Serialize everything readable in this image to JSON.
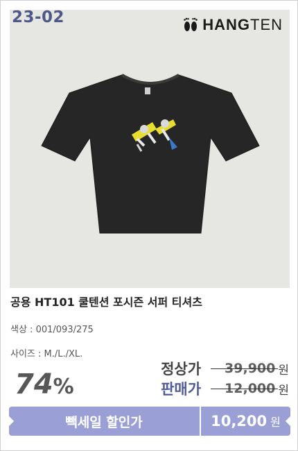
{
  "product": {
    "code": "23-02",
    "brand": {
      "bold": "HANG",
      "light": "TEN"
    },
    "title": "공용 HT101 쿨텐션 포시즌 서퍼 티셔츠",
    "color_label": "색상 :",
    "color_value": "001/093/275",
    "size_label": "사이즈 :",
    "size_value": "M./L./XL."
  },
  "pricing": {
    "discount_number": "74",
    "discount_symbol": "%",
    "regular_label": "정상가",
    "regular_price": "39,900",
    "sale_label": "판매가",
    "sale_price": "12,000",
    "currency": "원"
  },
  "promo": {
    "label": "빽세일 할인가",
    "price": "10,200",
    "currency": "원"
  },
  "colors": {
    "code_text": "#4e5987",
    "accent": "#9aa0d6",
    "sale_label": "#4f5b96",
    "photo_bg": "#e6e6e3"
  },
  "icons": [
    "footprints-icon"
  ]
}
